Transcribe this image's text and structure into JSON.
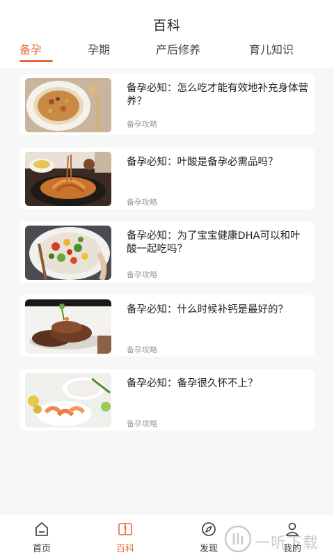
{
  "header": {
    "title": "百科",
    "tabs": [
      {
        "label": "备孕",
        "active": true
      },
      {
        "label": "孕期",
        "active": false
      },
      {
        "label": "产后修养",
        "active": false
      },
      {
        "label": "育儿知识",
        "active": false
      }
    ]
  },
  "articles": [
    {
      "title": "备孕必知：怎么吃才能有效地补充身体营养？",
      "tag": "备孕攻略",
      "image": "pasta-plate"
    },
    {
      "title": "备孕必知：叶酸是备孕必需品吗？",
      "tag": "备孕攻略",
      "image": "noodle-dish"
    },
    {
      "title": "备孕必知：为了宝宝健康DHA可以和叶酸一起吃吗？",
      "tag": "备孕攻略",
      "image": "vegetable-salad"
    },
    {
      "title": "备孕必知：什么时候补钙是最好的？",
      "tag": "备孕攻略",
      "image": "grilled-meat"
    },
    {
      "title": "备孕必知：备孕很久怀不上？",
      "tag": "备孕攻略",
      "image": "shrimp-rice"
    }
  ],
  "bottom_nav": [
    {
      "label": "首页",
      "icon": "home-icon",
      "active": false
    },
    {
      "label": "百科",
      "icon": "book-icon",
      "active": true
    },
    {
      "label": "发现",
      "icon": "compass-icon",
      "active": false
    },
    {
      "label": "我的",
      "icon": "user-icon",
      "active": false
    }
  ],
  "watermark": {
    "text": "一听下载"
  },
  "colors": {
    "accent": "#e36b3c",
    "background": "#f7f7f7",
    "card": "#ffffff",
    "muted": "#9a9a9a"
  }
}
